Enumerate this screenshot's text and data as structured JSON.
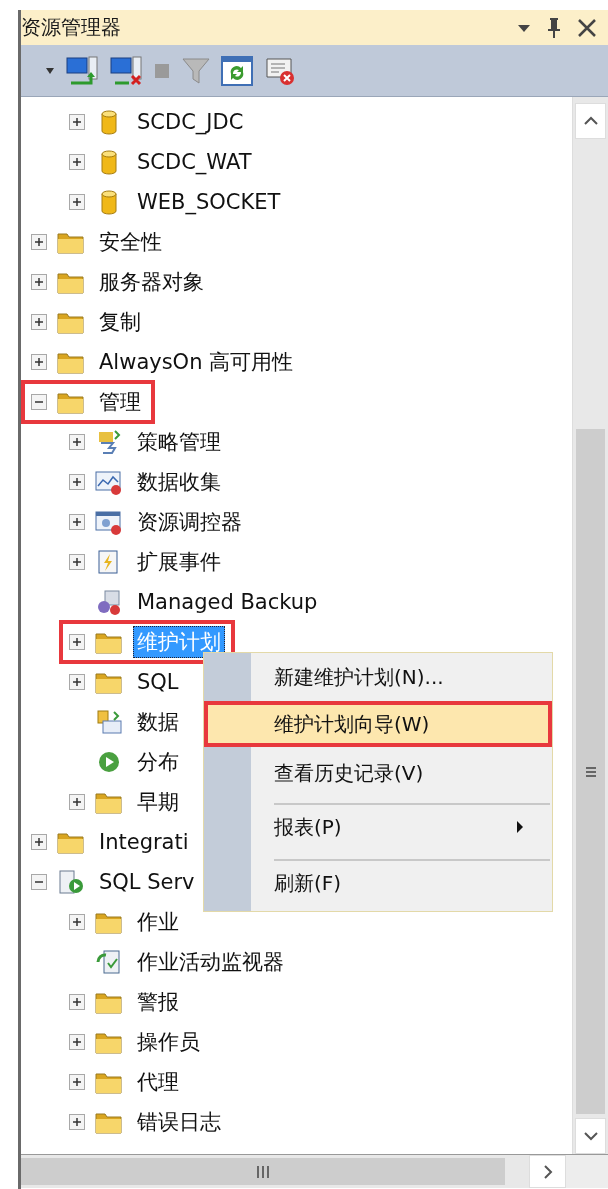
{
  "panel": {
    "title": "资源管理器"
  },
  "tree": {
    "continued_items": [
      {
        "label": "SCDC_JDC",
        "kind": "database",
        "expanded": false,
        "selected": false
      },
      {
        "label": "SCDC_WAT",
        "kind": "database",
        "expanded": false,
        "selected": false
      },
      {
        "label": "WEB_SOCKET",
        "kind": "database",
        "expanded": false,
        "selected": false
      }
    ],
    "items": [
      {
        "label": "安全性",
        "kind": "folder",
        "expanded": false,
        "selected": false
      },
      {
        "label": "服务器对象",
        "kind": "folder",
        "expanded": false,
        "selected": false
      },
      {
        "label": "复制",
        "kind": "folder",
        "expanded": false,
        "selected": false
      },
      {
        "label": "AlwaysOn 高可用性",
        "kind": "folder",
        "expanded": false,
        "selected": false
      },
      {
        "label": "管理",
        "kind": "folder",
        "expanded": true,
        "selected": false,
        "annotated": true,
        "children": [
          {
            "label": "策略管理",
            "kind": "policy",
            "expanded": false,
            "selected": false
          },
          {
            "label": "数据收集",
            "kind": "chart",
            "expanded": false,
            "selected": false
          },
          {
            "label": "资源调控器",
            "kind": "governor",
            "expanded": false,
            "selected": false
          },
          {
            "label": "扩展事件",
            "kind": "events",
            "expanded": false,
            "selected": false
          },
          {
            "label": "Managed Backup",
            "kind": "backup",
            "selected": false
          },
          {
            "label": "维护计划",
            "kind": "folder",
            "expanded": false,
            "selected": true,
            "annotated": true
          },
          {
            "label": "SQL",
            "kind": "folder",
            "expanded": false,
            "selected": false
          },
          {
            "label": "数据",
            "kind": "mail",
            "selected": false
          },
          {
            "label": "分布",
            "kind": "distributed",
            "selected": false
          },
          {
            "label": "早期",
            "kind": "folder",
            "expanded": false,
            "selected": false
          }
        ]
      },
      {
        "label": "Integrati",
        "kind": "folder",
        "expanded": false,
        "selected": false
      },
      {
        "label": "SQL Serv",
        "kind": "agent",
        "expanded": true,
        "selected": false,
        "children": [
          {
            "label": "作业",
            "kind": "folder",
            "expanded": false,
            "selected": false
          },
          {
            "label": "作业活动监视器",
            "kind": "monitor",
            "selected": false
          },
          {
            "label": "警报",
            "kind": "folder",
            "expanded": false,
            "selected": false
          },
          {
            "label": "操作员",
            "kind": "folder",
            "expanded": false,
            "selected": false
          },
          {
            "label": "代理",
            "kind": "folder",
            "expanded": false,
            "selected": false
          },
          {
            "label": "错误日志",
            "kind": "folder",
            "expanded": false,
            "selected": false
          }
        ]
      }
    ]
  },
  "context_menu": {
    "items": [
      {
        "label": "新建维护计划(N)...",
        "selected": false,
        "annotated": false,
        "has_submenu": false,
        "separator_before": false
      },
      {
        "label": "维护计划向导(W)",
        "selected": true,
        "annotated": true,
        "has_submenu": false,
        "separator_before": false
      },
      {
        "label": "查看历史记录(V)",
        "selected": false,
        "annotated": false,
        "has_submenu": false,
        "separator_before": false
      },
      {
        "label": "报表(P)",
        "selected": false,
        "annotated": false,
        "has_submenu": true,
        "separator_before": true
      },
      {
        "label": "刷新(F)",
        "selected": false,
        "annotated": false,
        "has_submenu": false,
        "separator_before": true
      }
    ]
  }
}
